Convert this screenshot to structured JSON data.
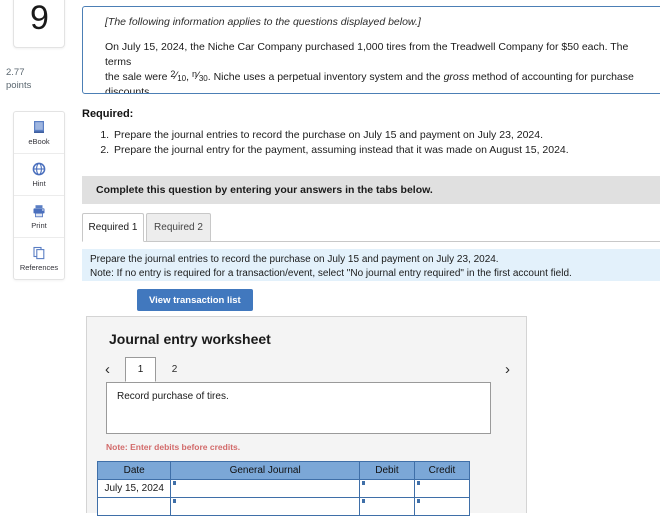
{
  "sidebar": {
    "question_number": "9",
    "points_value": "2.77",
    "points_label": "points",
    "tools": [
      {
        "icon": "ebook-icon",
        "label": "eBook"
      },
      {
        "icon": "hint-globe-icon",
        "label": "Hint"
      },
      {
        "icon": "printer-icon",
        "label": "Print"
      },
      {
        "icon": "references-copy-icon",
        "label": "References"
      }
    ]
  },
  "info_box": {
    "italic_note": "[The following information applies to the questions displayed below.]",
    "body_part1": "On July 15, 2024, the Niche Car Company purchased 1,000 tires from the Treadwell Company for $50 each. The terms",
    "body_part2_pre": "the sale were",
    "term1_numerator": "2",
    "term1_denominator": "10",
    "term2_numerator": "n",
    "term2_denominator": "30",
    "body_part2_post_a": ". Niche uses a perpetual inventory system and the",
    "body_part2_italic": "gross",
    "body_part2_post_b": "method of accounting for purchase",
    "body_part3": "discounts."
  },
  "required": {
    "heading": "Required:",
    "items": [
      "Prepare the journal entries to record the purchase on July 15 and payment on July 23, 2024.",
      "Prepare the journal entry for the payment, assuming instead that it was made on August 15, 2024."
    ]
  },
  "complete_bar": {
    "text": "Complete this question by entering your answers in the tabs below."
  },
  "tabs": [
    {
      "label": "Required 1",
      "active": true
    },
    {
      "label": "Required 2",
      "active": false
    }
  ],
  "note_band": {
    "line1": "Prepare the journal entries to record the purchase on July 15 and payment on July 23, 2024.",
    "line2": "Note: If no entry is required for a transaction/event, select \"No journal entry required\" in the first account field."
  },
  "buttons": {
    "view_transaction_list": "View transaction list"
  },
  "worksheet": {
    "title": "Journal entry worksheet",
    "prev_arrow": "‹",
    "next_arrow": "›",
    "pages": [
      "1",
      "2"
    ],
    "active_page": "1",
    "description": "Record purchase of tires.",
    "note": "Note: Enter debits before credits.",
    "table": {
      "headers": [
        "Date",
        "General Journal",
        "Debit",
        "Credit"
      ],
      "rows": [
        {
          "date": "July 15, 2024",
          "general_journal": "",
          "debit": "",
          "credit": ""
        },
        {
          "date": "",
          "general_journal": "",
          "debit": "",
          "credit": ""
        }
      ]
    }
  },
  "colors": {
    "accent_blue": "#4178be",
    "table_header_blue": "#7ba7d7",
    "table_border_blue": "#3f6fa8",
    "note_band_blue": "#e3f1fb",
    "info_border_blue": "#4c7fb5",
    "complete_bar_gray": "#e0e0e0",
    "note_red": "#d26a6a"
  }
}
